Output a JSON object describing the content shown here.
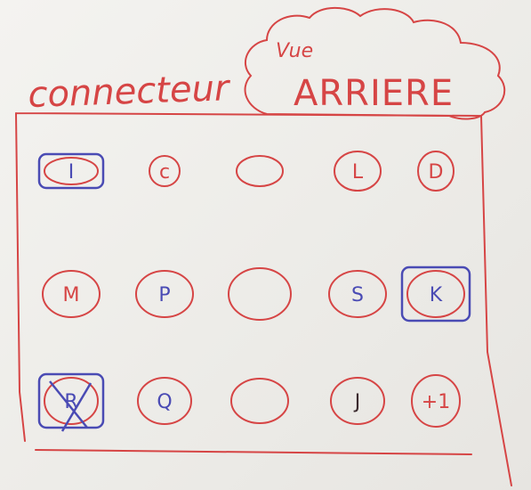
{
  "title": {
    "prefix": "connecteur",
    "view_word": "Vue",
    "view_side": "ARRIERE"
  },
  "colors": {
    "red": "#d64545",
    "blue": "#4a4bb4",
    "dark": "#3a2a2e"
  },
  "connector": {
    "rows": [
      {
        "pins": [
          {
            "label": "I",
            "shape": "square",
            "ink": "blue",
            "marked": true
          },
          {
            "label": "c",
            "shape": "circle",
            "ink": "red",
            "marked": false
          },
          {
            "label": "",
            "shape": "circle",
            "ink": "red",
            "marked": false
          },
          {
            "label": "L",
            "shape": "circle",
            "ink": "red",
            "marked": false
          },
          {
            "label": "D",
            "shape": "circle",
            "ink": "red",
            "marked": false
          }
        ]
      },
      {
        "pins": [
          {
            "label": "M",
            "shape": "circle",
            "ink": "red",
            "marked": false
          },
          {
            "label": "P",
            "shape": "circle",
            "ink": "blue",
            "marked": false
          },
          {
            "label": "",
            "shape": "circle",
            "ink": "red",
            "marked": false
          },
          {
            "label": "S",
            "shape": "circle",
            "ink": "blue",
            "marked": false
          },
          {
            "label": "K",
            "shape": "square",
            "ink": "blue",
            "marked": true
          }
        ]
      },
      {
        "pins": [
          {
            "label": "R",
            "shape": "square",
            "ink": "blue",
            "marked": true
          },
          {
            "label": "Q",
            "shape": "circle",
            "ink": "blue",
            "marked": false
          },
          {
            "label": "",
            "shape": "circle",
            "ink": "red",
            "marked": false
          },
          {
            "label": "J",
            "shape": "circle",
            "ink": "dark",
            "marked": false
          },
          {
            "label": "+1",
            "shape": "circle",
            "ink": "red",
            "marked": false
          }
        ]
      }
    ]
  }
}
